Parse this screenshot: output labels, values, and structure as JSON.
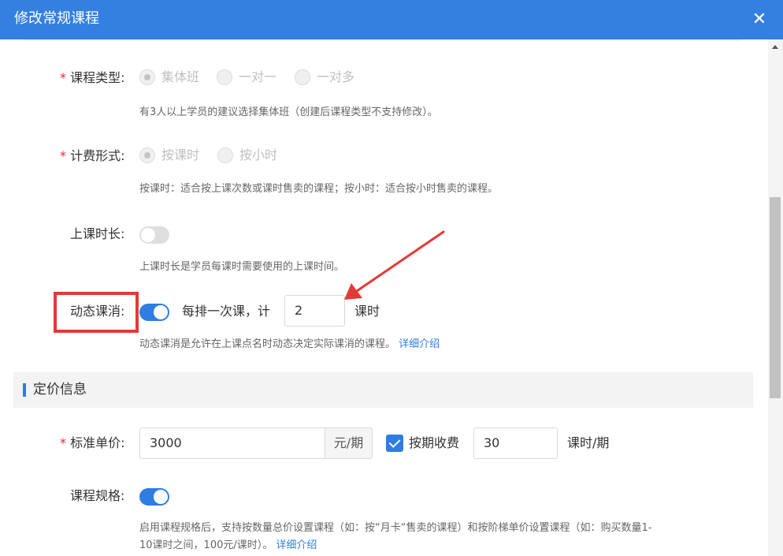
{
  "dialog": {
    "title": "修改常规课程",
    "close_icon": "close-icon"
  },
  "course_type": {
    "required_mark": "*",
    "label": "课程类型:",
    "options": [
      "集体班",
      "一对一",
      "一对多"
    ],
    "selected": "集体班",
    "hint": "有3人以上学员的建议选择集体班（创建后课程类型不支持修改）。"
  },
  "billing": {
    "required_mark": "*",
    "label": "计费形式:",
    "options": [
      "按课时",
      "按小时"
    ],
    "selected": "按课时",
    "hint": "按课时：适合按上课次数或课时售卖的课程；按小时：适合按小时售卖的课程。"
  },
  "duration": {
    "label": "上课时长:",
    "enabled": false,
    "hint": "上课时长是学员每课时需要使用的上课时间。"
  },
  "dynamic_deduct": {
    "label": "动态课消:",
    "enabled": true,
    "prefix": "每排一次课，计",
    "value": "2",
    "suffix": "课时",
    "hint": "动态课消是允许在上课点名时动态决定实际课消的课程。",
    "link": "详细介绍",
    "highlight_color": "#e53935"
  },
  "pricing_section": {
    "title": "定价信息"
  },
  "unit_price": {
    "required_mark": "*",
    "label": "标准单价:",
    "value": "3000",
    "unit": "元/期",
    "checkbox_label": "按期收费",
    "checked": true,
    "period_value": "30",
    "period_unit": "课时/期"
  },
  "spec": {
    "label": "课程规格:",
    "enabled": true,
    "hint_line1": "启用课程规格后，支持按数量总价设置课程（如：按“月卡“售卖的课程）和按阶梯单价设置课程（如：购买数量1-",
    "hint_line2": "10课时之间，100元/课时）。",
    "link": "详细介绍"
  },
  "colors": {
    "header": "#3380e0",
    "accent": "#2f7de1",
    "required": "#f5222d"
  }
}
